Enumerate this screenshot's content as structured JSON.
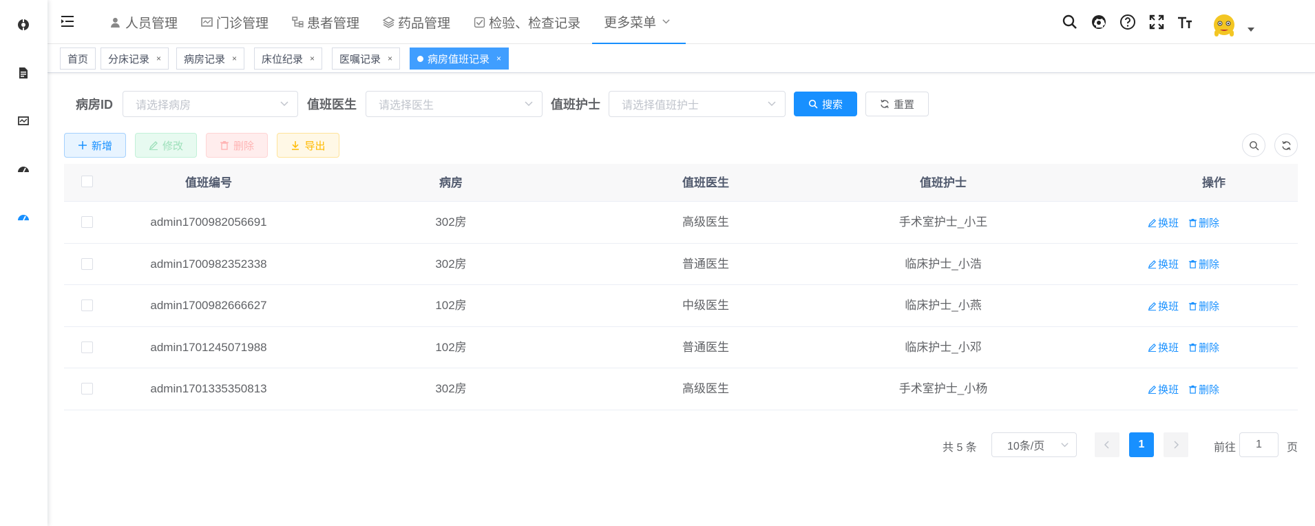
{
  "topnav": {
    "menu": [
      {
        "label": "人员管理",
        "icon": "user-icon"
      },
      {
        "label": "门诊管理",
        "icon": "monitor-icon"
      },
      {
        "label": "患者管理",
        "icon": "tree-icon"
      },
      {
        "label": "药品管理",
        "icon": "layers-icon"
      },
      {
        "label": "检验、检查记录",
        "icon": "checkbox-icon"
      },
      {
        "label": "更多菜单",
        "icon": "chevron-down-icon"
      }
    ]
  },
  "tags": [
    {
      "label": "首页",
      "closable": false,
      "active": false
    },
    {
      "label": "分床记录",
      "closable": true,
      "active": false
    },
    {
      "label": "病房记录",
      "closable": true,
      "active": false
    },
    {
      "label": "床位纪录",
      "closable": true,
      "active": false
    },
    {
      "label": "医嘱记录",
      "closable": true,
      "active": false
    },
    {
      "label": "病房值班记录",
      "closable": true,
      "active": true
    }
  ],
  "close_glyph": "×",
  "search": {
    "room_label": "病房ID",
    "room_placeholder": "请选择病房",
    "doctor_label": "值班医生",
    "doctor_placeholder": "请选择医生",
    "nurse_label": "值班护士",
    "nurse_placeholder": "请选择值班护士",
    "search_btn": "搜索",
    "reset_btn": "重置"
  },
  "toolbar": {
    "add": "新增",
    "edit": "修改",
    "delete": "删除",
    "export": "导出"
  },
  "table": {
    "headers": [
      "值班编号",
      "病房",
      "值班医生",
      "值班护士",
      "操作"
    ],
    "rows": [
      {
        "id": "admin1700982056691",
        "room": "302房",
        "doctor": "高级医生",
        "nurse": "手术室护士_小王"
      },
      {
        "id": "admin1700982352338",
        "room": "302房",
        "doctor": "普通医生",
        "nurse": "临床护士_小浩"
      },
      {
        "id": "admin1700982666627",
        "room": "102房",
        "doctor": "中级医生",
        "nurse": "临床护士_小燕"
      },
      {
        "id": "admin1701245071988",
        "room": "102房",
        "doctor": "普通医生",
        "nurse": "临床护士_小邓"
      },
      {
        "id": "admin1701335350813",
        "room": "302房",
        "doctor": "高级医生",
        "nurse": "手术室护士_小杨"
      }
    ],
    "op_swap": "换班",
    "op_delete": "删除"
  },
  "pagination": {
    "total": "共 5 条",
    "page_size": "10条/页",
    "current": "1",
    "goto_prefix": "前往",
    "goto_value": "1",
    "goto_suffix": "页"
  },
  "colors": {
    "primary": "#1890ff",
    "active_tag": "#409eff"
  }
}
